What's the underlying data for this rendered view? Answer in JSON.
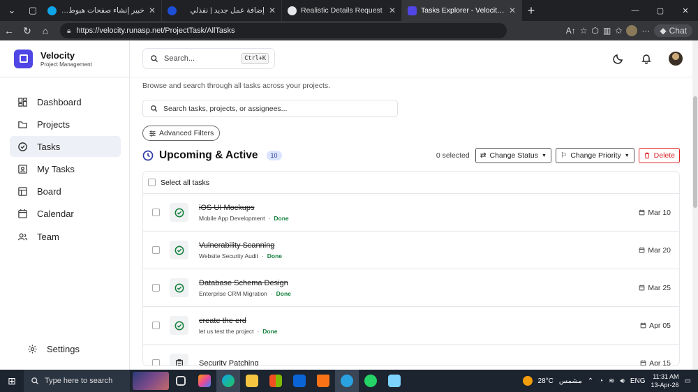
{
  "browser": {
    "tabs": [
      {
        "title": "خبير إنشاء صفحات هبوط ومسارات بيع",
        "color": "#3b82f6"
      },
      {
        "title": "إضافة عمل جديد | نفذلي",
        "color": "#0ea5e9"
      },
      {
        "title": "Realistic Details Request",
        "color": "#e5e7eb"
      },
      {
        "title": "Tasks Explorer - Velocity Dashboard",
        "color": "#4f46e5"
      }
    ],
    "url": "https://velocity.runasp.net/ProjectTask/AllTasks",
    "chat_label": "Chat"
  },
  "brand": {
    "name": "Velocity",
    "sub": "Project Management"
  },
  "nav": [
    {
      "label": "Dashboard",
      "icon": "dashboard-icon"
    },
    {
      "label": "Projects",
      "icon": "folder-icon"
    },
    {
      "label": "Tasks",
      "icon": "check-circle-icon"
    },
    {
      "label": "My Tasks",
      "icon": "user-card-icon"
    },
    {
      "label": "Board",
      "icon": "board-icon"
    },
    {
      "label": "Calendar",
      "icon": "calendar-icon"
    },
    {
      "label": "Team",
      "icon": "team-icon"
    }
  ],
  "settings_label": "Settings",
  "topbar": {
    "search_placeholder": "Search...",
    "shortcut": "Ctrl+K"
  },
  "page": {
    "subtitle": "Browse and search through all tasks across your projects.",
    "search_placeholder": "Search tasks, projects, or assignees...",
    "advanced_filters": "Advanced Filters",
    "section_title": "Upcoming & Active",
    "count": "10",
    "selected": "0 selected",
    "change_status": "Change Status",
    "change_priority": "Change Priority",
    "delete": "Delete",
    "select_all": "Select all tasks"
  },
  "tasks": [
    {
      "name": "iOS UI Mockups",
      "project": "Mobile App Development",
      "status": "Done",
      "date": "Mar 10",
      "done": true
    },
    {
      "name": "Vulnerability Scanning",
      "project": "Website Security Audit",
      "status": "Done",
      "date": "Mar 20",
      "done": true
    },
    {
      "name": "Database Schema Design",
      "project": "Enterprise CRM Migration",
      "status": "Done",
      "date": "Mar 25",
      "done": true
    },
    {
      "name": "create the erd",
      "project": "let us test the project",
      "status": "Done",
      "date": "Apr 05",
      "done": true
    },
    {
      "name": "Security Patching",
      "project": "",
      "status": "",
      "date": "Apr 15",
      "done": false
    }
  ],
  "taskbar": {
    "search": "Type here to search",
    "weather": "28°C",
    "weather_label": "مشمس",
    "lang": "ENG",
    "time": "11:31 AM",
    "date": "13-Apr-26"
  }
}
